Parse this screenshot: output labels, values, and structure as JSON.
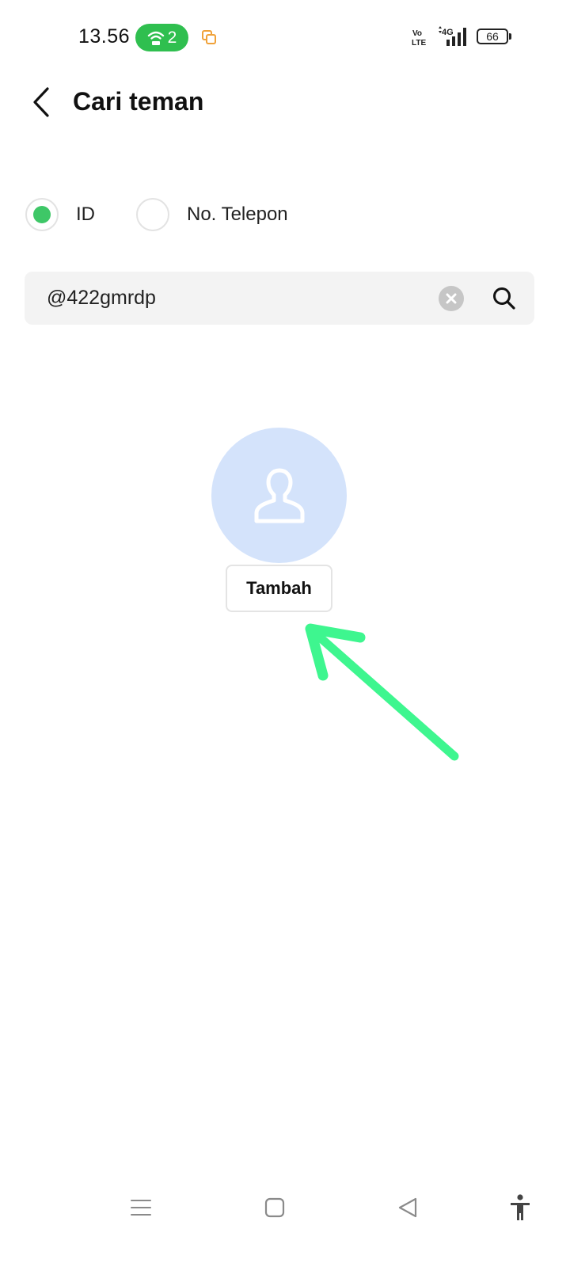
{
  "status_bar": {
    "time": "13.56",
    "hotspot_count": "2",
    "volte_top": "Vo",
    "volte_bottom": "LTE",
    "network": "4G",
    "battery": "66"
  },
  "header": {
    "title": "Cari teman"
  },
  "search_type": {
    "options": [
      {
        "label": "ID",
        "selected": true
      },
      {
        "label": "No. Telepon",
        "selected": false
      }
    ]
  },
  "search": {
    "value": "@422gmrdp"
  },
  "result": {
    "add_label": "Tambah"
  },
  "colors": {
    "accent_green": "#3ec767",
    "hotspot_green": "#2fbf4f",
    "avatar_bg": "#d4e3fb",
    "arrow_annotation": "#3ef68f"
  },
  "icons": [
    "back-icon",
    "hotspot-icon",
    "copy-icon",
    "signal-icon",
    "battery-icon",
    "clear-icon",
    "search-icon",
    "person-icon",
    "menu-icon",
    "home-icon",
    "nav-back-icon",
    "accessibility-icon"
  ]
}
